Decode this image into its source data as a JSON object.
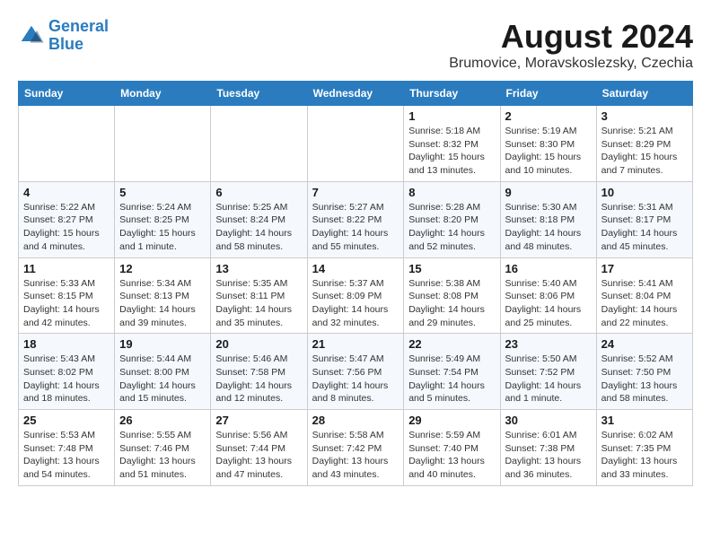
{
  "logo": {
    "line1": "General",
    "line2": "Blue"
  },
  "title": "August 2024",
  "location": "Brumovice, Moravskoslezsky, Czechia",
  "days_header": [
    "Sunday",
    "Monday",
    "Tuesday",
    "Wednesday",
    "Thursday",
    "Friday",
    "Saturday"
  ],
  "weeks": [
    [
      {
        "day": "",
        "info": ""
      },
      {
        "day": "",
        "info": ""
      },
      {
        "day": "",
        "info": ""
      },
      {
        "day": "",
        "info": ""
      },
      {
        "day": "1",
        "info": "Sunrise: 5:18 AM\nSunset: 8:32 PM\nDaylight: 15 hours\nand 13 minutes."
      },
      {
        "day": "2",
        "info": "Sunrise: 5:19 AM\nSunset: 8:30 PM\nDaylight: 15 hours\nand 10 minutes."
      },
      {
        "day": "3",
        "info": "Sunrise: 5:21 AM\nSunset: 8:29 PM\nDaylight: 15 hours\nand 7 minutes."
      }
    ],
    [
      {
        "day": "4",
        "info": "Sunrise: 5:22 AM\nSunset: 8:27 PM\nDaylight: 15 hours\nand 4 minutes."
      },
      {
        "day": "5",
        "info": "Sunrise: 5:24 AM\nSunset: 8:25 PM\nDaylight: 15 hours\nand 1 minute."
      },
      {
        "day": "6",
        "info": "Sunrise: 5:25 AM\nSunset: 8:24 PM\nDaylight: 14 hours\nand 58 minutes."
      },
      {
        "day": "7",
        "info": "Sunrise: 5:27 AM\nSunset: 8:22 PM\nDaylight: 14 hours\nand 55 minutes."
      },
      {
        "day": "8",
        "info": "Sunrise: 5:28 AM\nSunset: 8:20 PM\nDaylight: 14 hours\nand 52 minutes."
      },
      {
        "day": "9",
        "info": "Sunrise: 5:30 AM\nSunset: 8:18 PM\nDaylight: 14 hours\nand 48 minutes."
      },
      {
        "day": "10",
        "info": "Sunrise: 5:31 AM\nSunset: 8:17 PM\nDaylight: 14 hours\nand 45 minutes."
      }
    ],
    [
      {
        "day": "11",
        "info": "Sunrise: 5:33 AM\nSunset: 8:15 PM\nDaylight: 14 hours\nand 42 minutes."
      },
      {
        "day": "12",
        "info": "Sunrise: 5:34 AM\nSunset: 8:13 PM\nDaylight: 14 hours\nand 39 minutes."
      },
      {
        "day": "13",
        "info": "Sunrise: 5:35 AM\nSunset: 8:11 PM\nDaylight: 14 hours\nand 35 minutes."
      },
      {
        "day": "14",
        "info": "Sunrise: 5:37 AM\nSunset: 8:09 PM\nDaylight: 14 hours\nand 32 minutes."
      },
      {
        "day": "15",
        "info": "Sunrise: 5:38 AM\nSunset: 8:08 PM\nDaylight: 14 hours\nand 29 minutes."
      },
      {
        "day": "16",
        "info": "Sunrise: 5:40 AM\nSunset: 8:06 PM\nDaylight: 14 hours\nand 25 minutes."
      },
      {
        "day": "17",
        "info": "Sunrise: 5:41 AM\nSunset: 8:04 PM\nDaylight: 14 hours\nand 22 minutes."
      }
    ],
    [
      {
        "day": "18",
        "info": "Sunrise: 5:43 AM\nSunset: 8:02 PM\nDaylight: 14 hours\nand 18 minutes."
      },
      {
        "day": "19",
        "info": "Sunrise: 5:44 AM\nSunset: 8:00 PM\nDaylight: 14 hours\nand 15 minutes."
      },
      {
        "day": "20",
        "info": "Sunrise: 5:46 AM\nSunset: 7:58 PM\nDaylight: 14 hours\nand 12 minutes."
      },
      {
        "day": "21",
        "info": "Sunrise: 5:47 AM\nSunset: 7:56 PM\nDaylight: 14 hours\nand 8 minutes."
      },
      {
        "day": "22",
        "info": "Sunrise: 5:49 AM\nSunset: 7:54 PM\nDaylight: 14 hours\nand 5 minutes."
      },
      {
        "day": "23",
        "info": "Sunrise: 5:50 AM\nSunset: 7:52 PM\nDaylight: 14 hours\nand 1 minute."
      },
      {
        "day": "24",
        "info": "Sunrise: 5:52 AM\nSunset: 7:50 PM\nDaylight: 13 hours\nand 58 minutes."
      }
    ],
    [
      {
        "day": "25",
        "info": "Sunrise: 5:53 AM\nSunset: 7:48 PM\nDaylight: 13 hours\nand 54 minutes."
      },
      {
        "day": "26",
        "info": "Sunrise: 5:55 AM\nSunset: 7:46 PM\nDaylight: 13 hours\nand 51 minutes."
      },
      {
        "day": "27",
        "info": "Sunrise: 5:56 AM\nSunset: 7:44 PM\nDaylight: 13 hours\nand 47 minutes."
      },
      {
        "day": "28",
        "info": "Sunrise: 5:58 AM\nSunset: 7:42 PM\nDaylight: 13 hours\nand 43 minutes."
      },
      {
        "day": "29",
        "info": "Sunrise: 5:59 AM\nSunset: 7:40 PM\nDaylight: 13 hours\nand 40 minutes."
      },
      {
        "day": "30",
        "info": "Sunrise: 6:01 AM\nSunset: 7:38 PM\nDaylight: 13 hours\nand 36 minutes."
      },
      {
        "day": "31",
        "info": "Sunrise: 6:02 AM\nSunset: 7:35 PM\nDaylight: 13 hours\nand 33 minutes."
      }
    ]
  ]
}
